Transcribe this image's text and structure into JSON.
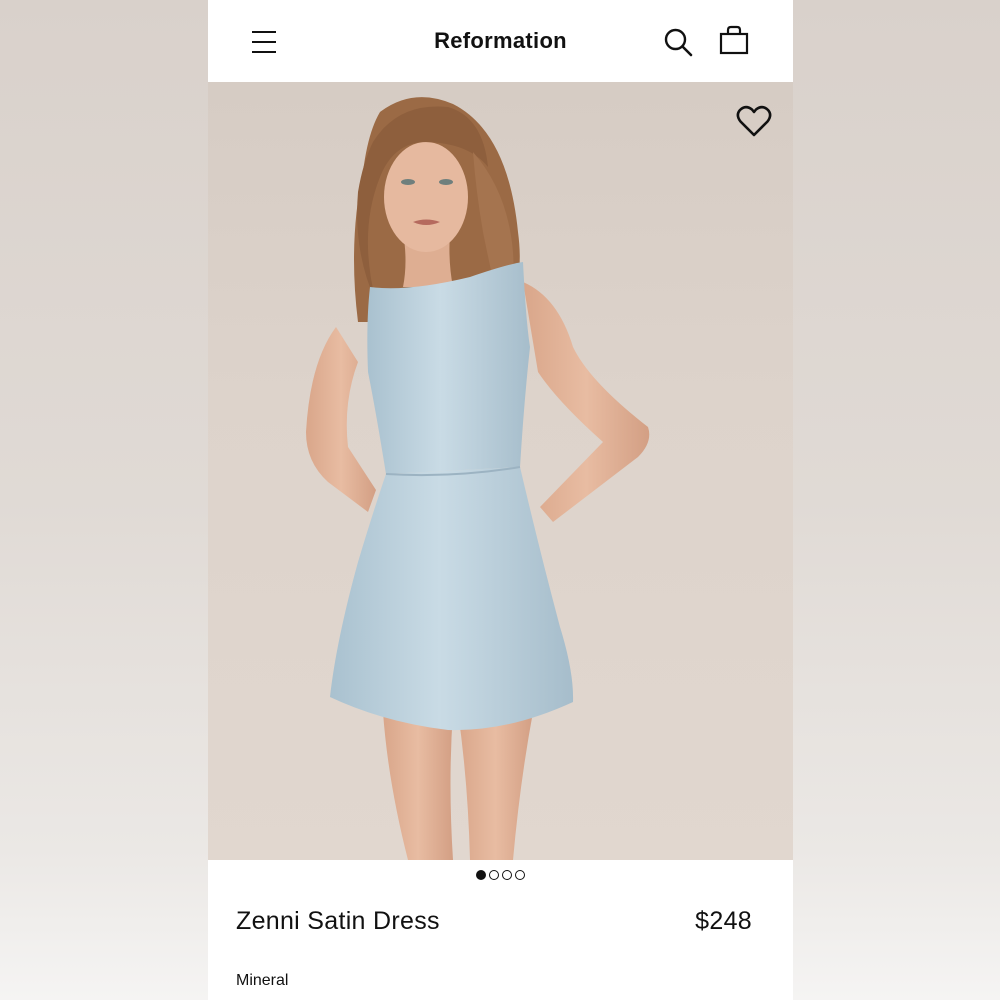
{
  "header": {
    "brand": "Reformation",
    "menu_icon": "hamburger-menu-icon",
    "search_icon": "search-icon",
    "bag_icon": "shopping-bag-icon"
  },
  "gallery": {
    "image_alt": "Model wearing Zenni Satin Dress in Mineral",
    "wishlist_icon": "heart-icon",
    "total_images": 4,
    "active_index": 0
  },
  "product": {
    "name": "Zenni Satin Dress",
    "price": "$248",
    "color": "Mineral"
  },
  "colors": {
    "text": "#111111",
    "dress": "#b9cfdb",
    "background": "#ffffff"
  }
}
